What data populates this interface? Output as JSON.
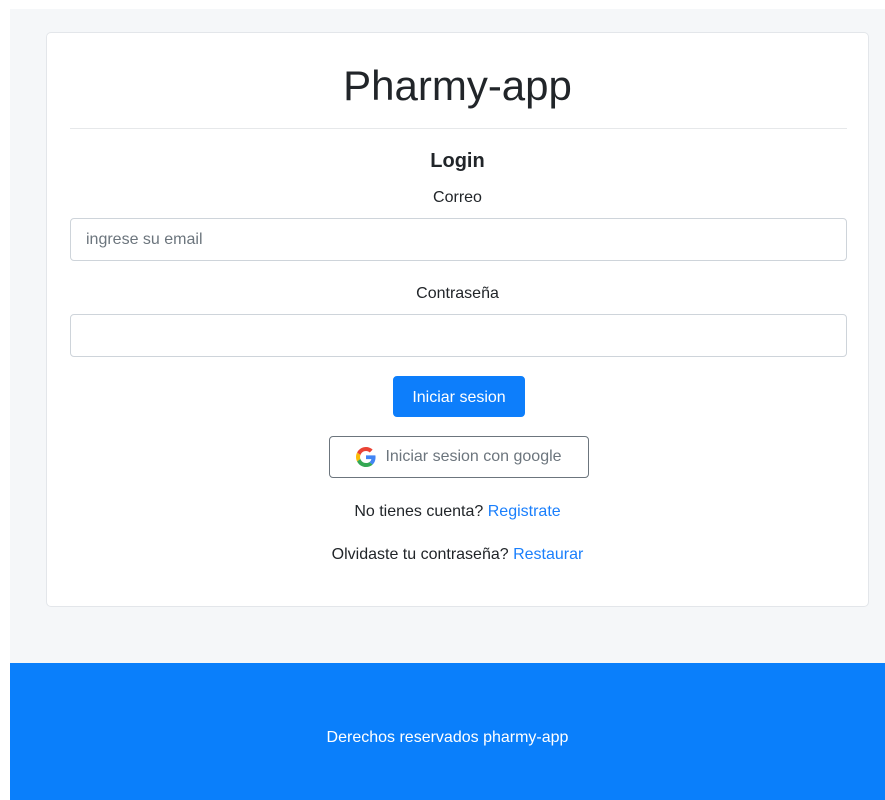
{
  "app": {
    "title": "Pharmy-app"
  },
  "login": {
    "heading": "Login",
    "email_label": "Correo",
    "email_placeholder": "ingrese su email",
    "email_value": "",
    "password_label": "Contraseña",
    "password_value": "",
    "submit_label": "Iniciar sesion",
    "google_label": "Iniciar sesion con google",
    "google_icon": "google-icon"
  },
  "links": {
    "register_prompt": "No tienes cuenta?",
    "register_link": "Registrate",
    "restore_prompt": "Olvidaste tu contraseña?",
    "restore_link": "Restaurar"
  },
  "footer": {
    "text": "Derechos reservados pharmy-app"
  },
  "colors": {
    "primary": "#0d7efb",
    "footer_bg": "#0a7ffb",
    "link": "#1a7ffc",
    "page_bg": "#f5f7f9"
  }
}
